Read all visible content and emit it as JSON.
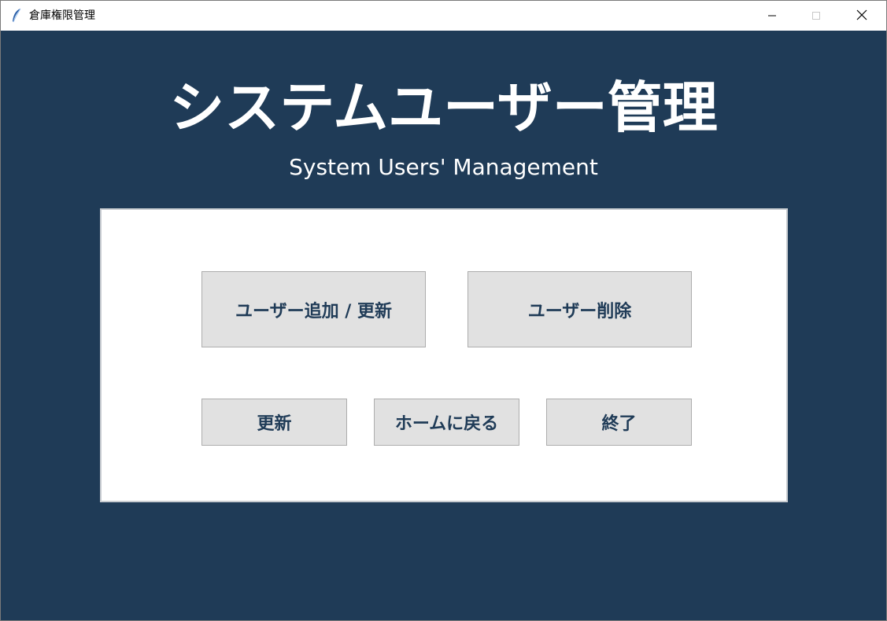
{
  "window": {
    "title": "倉庫権限管理",
    "controls": {
      "minimize": "minimize-icon",
      "maximize": "maximize-icon",
      "close": "close-icon"
    }
  },
  "header": {
    "title_ja": "システムユーザー管理",
    "title_en": "System Users' Management"
  },
  "buttons": {
    "add_update": "ユーザー追加 / 更新",
    "delete": "ユーザー削除",
    "refresh": "更新",
    "home": "ホームに戻る",
    "exit": "終了"
  },
  "colors": {
    "background": "#1f3b57",
    "panel": "#ffffff",
    "button_bg": "#e1e1e1",
    "button_text": "#1f3b57"
  }
}
